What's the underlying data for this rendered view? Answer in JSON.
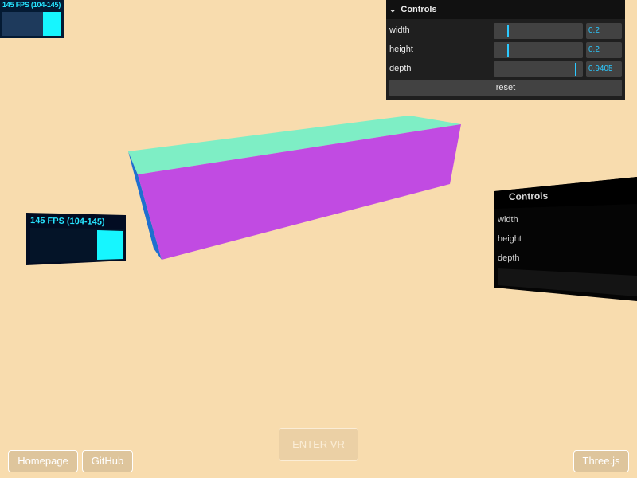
{
  "stats": {
    "fps_text": "145 FPS (104-145)"
  },
  "gui": {
    "title": "Controls",
    "controls": [
      {
        "label": "width",
        "value": "0.2",
        "fraction": 0.15
      },
      {
        "label": "height",
        "value": "0.2",
        "fraction": 0.15
      },
      {
        "label": "depth",
        "value": "0.9405",
        "fraction": 0.93
      }
    ],
    "reset_label": "reset"
  },
  "vr_stats": {
    "fps_text": "145 FPS (104-145)"
  },
  "vr_gui": {
    "title": "Controls",
    "labels": [
      "width",
      "height",
      "depth"
    ]
  },
  "buttons": {
    "enter_vr": "ENTER VR",
    "homepage": "Homepage",
    "github": "GitHub",
    "threejs": "Three.js"
  },
  "colors": {
    "background": "#f8dcae",
    "box_top": "#7eeec5",
    "box_front": "#c14be2",
    "box_side": "#1f6fcf",
    "accent": "#2cc9ff"
  }
}
